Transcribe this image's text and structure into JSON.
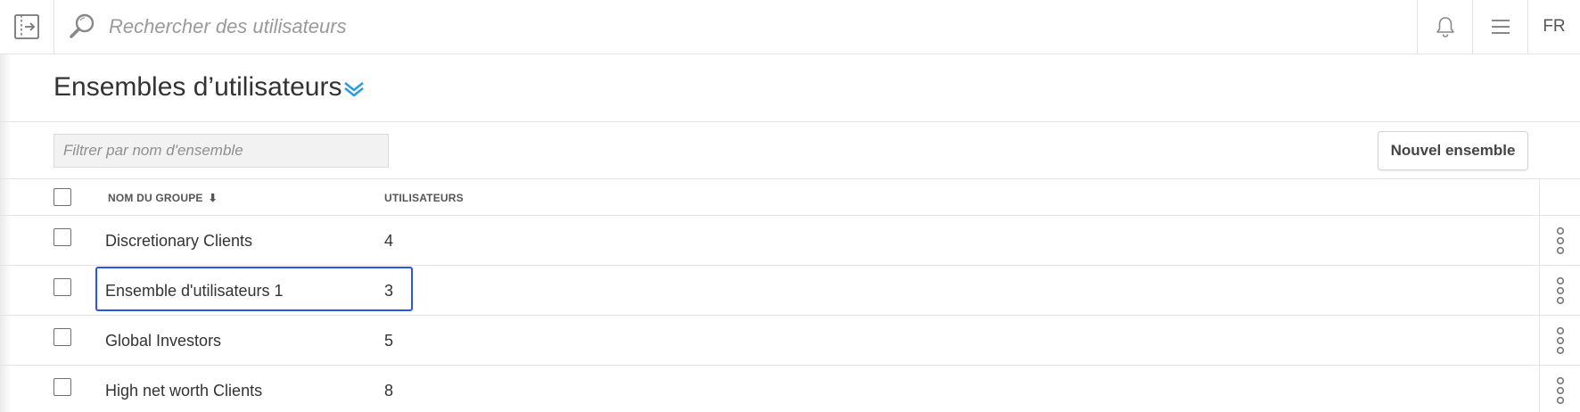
{
  "header": {
    "search_placeholder": "Rechercher des utilisateurs",
    "language": "FR",
    "icons": {
      "sidebar_toggle": "sidebar-expand-icon",
      "search": "search-icon",
      "notifications": "bell-icon",
      "menu": "hamburger-menu-icon"
    }
  },
  "page": {
    "title": "Ensembles d’utilisateurs",
    "title_icon": "chevron-double-down-icon",
    "accent_color": "#2e9be0"
  },
  "toolbar": {
    "filter_placeholder": "Filtrer par nom d'ensemble",
    "new_set_label": "Nouvel ensemble"
  },
  "table": {
    "columns": {
      "name": "NOM DU GROUPE",
      "name_sort_icon": "⬇",
      "users": "UTILISATEURS"
    },
    "rows": [
      {
        "name": "Discretionary Clients",
        "users": "4"
      },
      {
        "name": "Ensemble d'utilisateurs 1",
        "users": "3",
        "highlighted": true
      },
      {
        "name": "Global Investors",
        "users": "5"
      },
      {
        "name": "High net worth Clients",
        "users": "8"
      }
    ],
    "highlight_color": "#2b55e6"
  }
}
